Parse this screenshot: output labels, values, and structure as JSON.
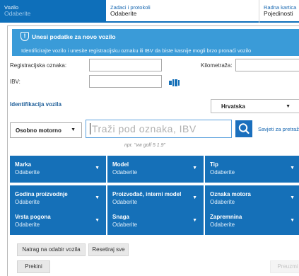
{
  "tabs": [
    {
      "label": "Vozilo",
      "value": "Odaberite"
    },
    {
      "label": "Zadaci i protokoli",
      "value": "Odaberite"
    },
    {
      "label": "Radna kartica",
      "value": "Pojedinosti"
    }
  ],
  "banner": {
    "icon": "info-icon",
    "title": "Unesi podatke za novo vozilo",
    "text": "Identificirajte vozilo i unesite registracijsku oznaku ili IBV da biste kasnije mogli brzo pronaći vozilo"
  },
  "form": {
    "reg_label": "Registracijska oznaka:",
    "reg_value": "",
    "km_label": "Kilometraža:",
    "km_value": "",
    "ibv_label": "IBV:",
    "ibv_value": ""
  },
  "identification": {
    "title": "Identifikacija vozila",
    "country": "Hrvatska",
    "vehicle_type": "Osobno motorno",
    "search_placeholder": "Traži pod oznaka, IBV",
    "search_tips": "Savjeti za pretraž",
    "hint": "npr. \"vw golf 5 1.9\""
  },
  "dropdowns": [
    {
      "label": "Marka",
      "value": "Odaberite"
    },
    {
      "label": "Model",
      "value": "Odaberite"
    },
    {
      "label": "Tip",
      "value": "Odaberite"
    },
    {
      "label": "Godina proizvodnje",
      "value": "Odaberite"
    },
    {
      "label": "Proizvođač, interni model",
      "value": "Odaberite"
    },
    {
      "label": "Oznaka motora",
      "value": "Odaberite"
    },
    {
      "label": "Vrsta pogona",
      "value": "Odaberite"
    },
    {
      "label": "Snaga",
      "value": "Odaberite"
    },
    {
      "label": "Zapremnina",
      "value": "Odaberite"
    }
  ],
  "buttons": {
    "back": "Natrag na odabir vozila",
    "reset": "Resetiraj sve",
    "cancel": "Prekini",
    "accept": "Preuzmi"
  },
  "colors": {
    "primary": "#1570b8",
    "banner": "#3a9bd8",
    "link": "#1566b0"
  }
}
